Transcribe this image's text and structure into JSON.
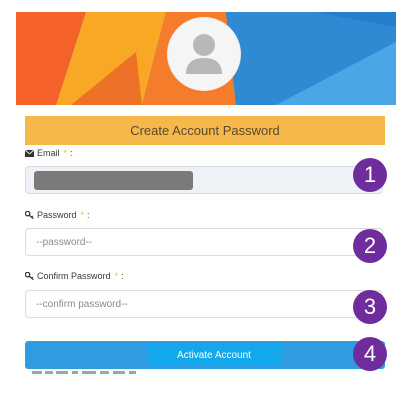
{
  "form": {
    "title": "Create Account Password",
    "email": {
      "label": "Email",
      "required_marker": "*",
      "label_suffix": ":",
      "value_redacted": true
    },
    "password": {
      "label": "Password",
      "required_marker": "*",
      "label_suffix": ":",
      "placeholder": "--password--",
      "value": ""
    },
    "confirm_password": {
      "label": "Confirm Password",
      "required_marker": "*",
      "label_suffix": ":",
      "placeholder": "--confirm password--",
      "value": ""
    },
    "submit_label": "Activate Account"
  },
  "step_badges": [
    "1",
    "2",
    "3",
    "4"
  ],
  "icons": {
    "email": "envelope-icon",
    "password": "key-icon",
    "confirm_password": "key-icon",
    "avatar": "user-silhouette-icon"
  },
  "colors": {
    "title_bar": "#f6b84b",
    "submit_bar": "#2f9be0",
    "submit_button": "#13a8ec",
    "badge": "#6e2c9c",
    "banner_blue": "#3f96d8",
    "banner_orange": "#f26b2c",
    "banner_yellow": "#f9a825"
  }
}
